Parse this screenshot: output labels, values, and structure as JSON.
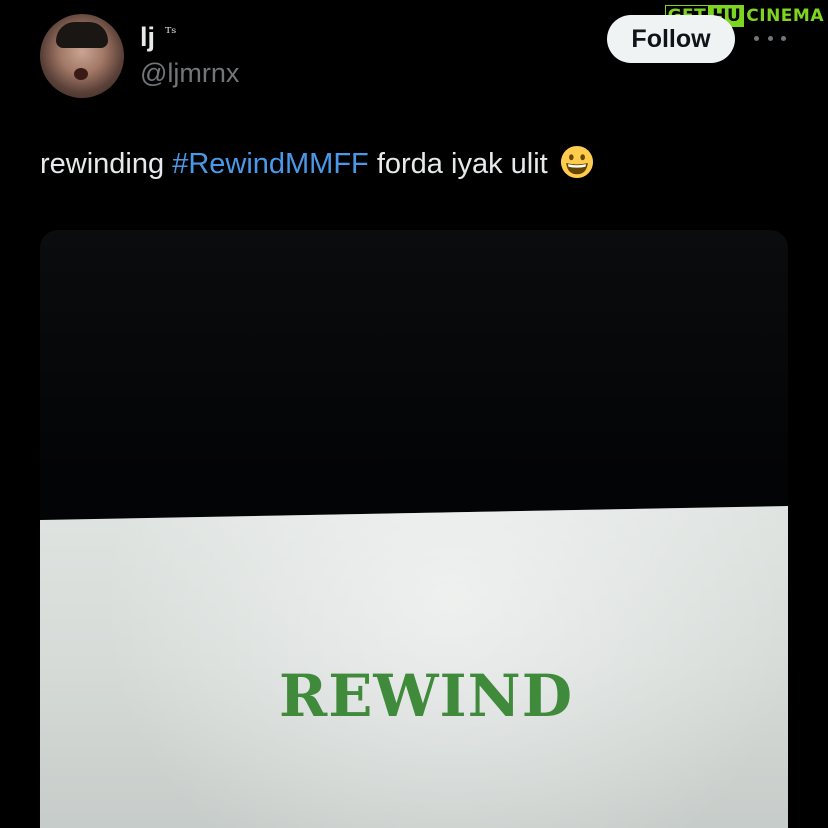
{
  "watermark": {
    "part_a": "GET",
    "part_b": "HU",
    "part_c": "CINEMA"
  },
  "tweet": {
    "display_name": "lj",
    "name_badge": "ᵀˢ",
    "handle": "@ljmrnx",
    "follow_label": "Follow",
    "more_icon": "more-horizontal-icon",
    "text_before": "rewinding ",
    "hashtag": "#RewindMMFF",
    "text_after": " forda iyak ulit",
    "emoji": "grinning-face-emoji"
  },
  "media": {
    "screen_text": "REWIND"
  },
  "colors": {
    "background": "#000000",
    "hashtag": "#4a99e9",
    "follow_bg": "#eff3f4",
    "screen_text": "#3f8a3b",
    "watermark": "#7dd421"
  }
}
